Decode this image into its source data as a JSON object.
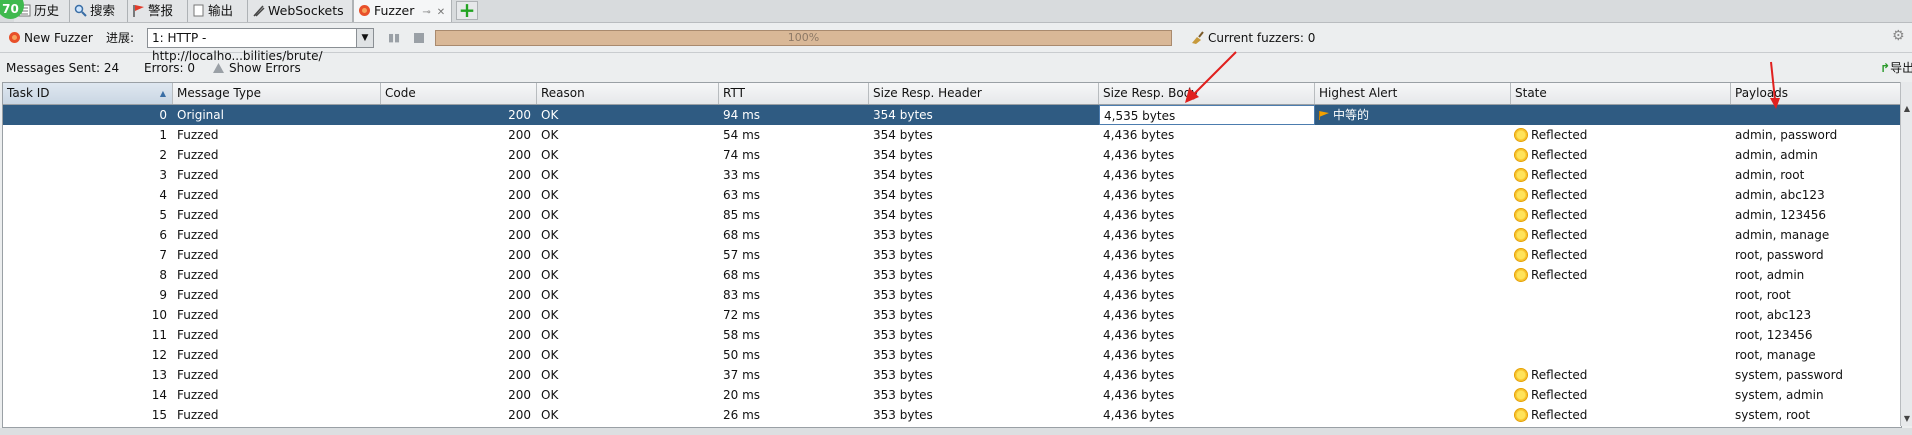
{
  "tabs": {
    "badge": "70",
    "items": [
      {
        "label": "历史",
        "icon": "history-icon"
      },
      {
        "label": "搜索",
        "icon": "search-icon"
      },
      {
        "label": "警报",
        "icon": "flag-icon"
      },
      {
        "label": "输出",
        "icon": "output-icon"
      },
      {
        "label": "WebSockets",
        "icon": "websockets-icon"
      },
      {
        "label": "Fuzzer",
        "icon": "fuzzer-icon"
      }
    ],
    "pin_glyph": "✕"
  },
  "toolbar": {
    "new_fuzzer": "New Fuzzer",
    "progress_label": "进展:",
    "selected_fuzzer": "1: HTTP - http://localho...bilities/brute/",
    "progress_value": 100,
    "progress_text": "100%",
    "current_fuzzers": "Current fuzzers: 0",
    "export_label": "导出"
  },
  "infobar": {
    "messages_sent": "Messages Sent: 24",
    "errors": "Errors: 0",
    "show_errors": "Show Errors"
  },
  "table": {
    "columns": [
      "Task ID",
      "Message Type",
      "Code",
      "Reason",
      "RTT",
      "Size Resp. Header",
      "Size Resp. Body",
      "Highest Alert",
      "State",
      "Payloads"
    ],
    "rows": [
      {
        "id": "0",
        "type": "Original",
        "code": "200",
        "reason": "OK",
        "rtt": "94 ms",
        "hdr": "354 bytes",
        "body": "4,535 bytes",
        "alert": "中等的",
        "state": "",
        "payload": ""
      },
      {
        "id": "1",
        "type": "Fuzzed",
        "code": "200",
        "reason": "OK",
        "rtt": "54 ms",
        "hdr": "354 bytes",
        "body": "4,436 bytes",
        "alert": "",
        "state": "Reflected",
        "payload": "admin, password"
      },
      {
        "id": "2",
        "type": "Fuzzed",
        "code": "200",
        "reason": "OK",
        "rtt": "74 ms",
        "hdr": "354 bytes",
        "body": "4,436 bytes",
        "alert": "",
        "state": "Reflected",
        "payload": "admin, admin"
      },
      {
        "id": "3",
        "type": "Fuzzed",
        "code": "200",
        "reason": "OK",
        "rtt": "33 ms",
        "hdr": "354 bytes",
        "body": "4,436 bytes",
        "alert": "",
        "state": "Reflected",
        "payload": "admin, root"
      },
      {
        "id": "4",
        "type": "Fuzzed",
        "code": "200",
        "reason": "OK",
        "rtt": "63 ms",
        "hdr": "354 bytes",
        "body": "4,436 bytes",
        "alert": "",
        "state": "Reflected",
        "payload": "admin, abc123"
      },
      {
        "id": "5",
        "type": "Fuzzed",
        "code": "200",
        "reason": "OK",
        "rtt": "85 ms",
        "hdr": "354 bytes",
        "body": "4,436 bytes",
        "alert": "",
        "state": "Reflected",
        "payload": "admin, 123456"
      },
      {
        "id": "6",
        "type": "Fuzzed",
        "code": "200",
        "reason": "OK",
        "rtt": "68 ms",
        "hdr": "353 bytes",
        "body": "4,436 bytes",
        "alert": "",
        "state": "Reflected",
        "payload": "admin, manage"
      },
      {
        "id": "7",
        "type": "Fuzzed",
        "code": "200",
        "reason": "OK",
        "rtt": "57 ms",
        "hdr": "353 bytes",
        "body": "4,436 bytes",
        "alert": "",
        "state": "Reflected",
        "payload": "root, password"
      },
      {
        "id": "8",
        "type": "Fuzzed",
        "code": "200",
        "reason": "OK",
        "rtt": "68 ms",
        "hdr": "353 bytes",
        "body": "4,436 bytes",
        "alert": "",
        "state": "Reflected",
        "payload": "root, admin"
      },
      {
        "id": "9",
        "type": "Fuzzed",
        "code": "200",
        "reason": "OK",
        "rtt": "83 ms",
        "hdr": "353 bytes",
        "body": "4,436 bytes",
        "alert": "",
        "state": "",
        "payload": "root, root"
      },
      {
        "id": "10",
        "type": "Fuzzed",
        "code": "200",
        "reason": "OK",
        "rtt": "72 ms",
        "hdr": "353 bytes",
        "body": "4,436 bytes",
        "alert": "",
        "state": "",
        "payload": "root, abc123"
      },
      {
        "id": "11",
        "type": "Fuzzed",
        "code": "200",
        "reason": "OK",
        "rtt": "58 ms",
        "hdr": "353 bytes",
        "body": "4,436 bytes",
        "alert": "",
        "state": "",
        "payload": "root, 123456"
      },
      {
        "id": "12",
        "type": "Fuzzed",
        "code": "200",
        "reason": "OK",
        "rtt": "50 ms",
        "hdr": "353 bytes",
        "body": "4,436 bytes",
        "alert": "",
        "state": "",
        "payload": "root, manage"
      },
      {
        "id": "13",
        "type": "Fuzzed",
        "code": "200",
        "reason": "OK",
        "rtt": "37 ms",
        "hdr": "353 bytes",
        "body": "4,436 bytes",
        "alert": "",
        "state": "Reflected",
        "payload": "system, password"
      },
      {
        "id": "14",
        "type": "Fuzzed",
        "code": "200",
        "reason": "OK",
        "rtt": "20 ms",
        "hdr": "353 bytes",
        "body": "4,436 bytes",
        "alert": "",
        "state": "Reflected",
        "payload": "system, admin"
      },
      {
        "id": "15",
        "type": "Fuzzed",
        "code": "200",
        "reason": "OK",
        "rtt": "26 ms",
        "hdr": "353 bytes",
        "body": "4,436 bytes",
        "alert": "",
        "state": "Reflected",
        "payload": "system, root"
      }
    ]
  },
  "colors": {
    "selected_row": "#2f5b82",
    "annotation_arrow": "#e0201e",
    "progress_fill": "#d9b897"
  }
}
